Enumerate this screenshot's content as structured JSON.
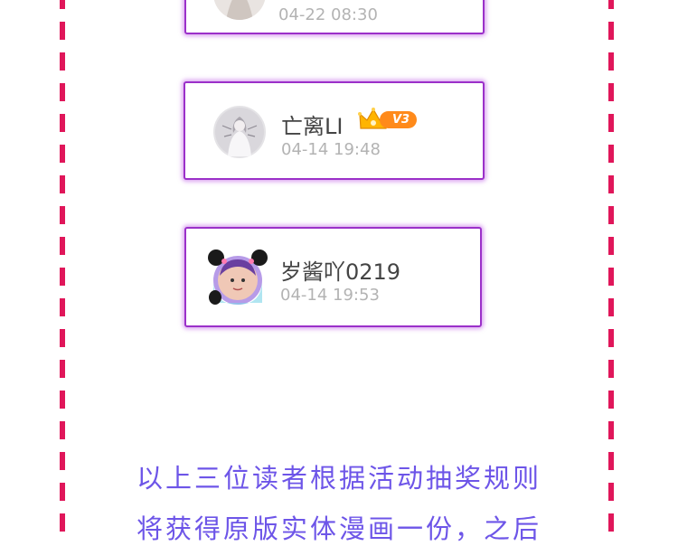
{
  "colors": {
    "dash": "#e0165a",
    "card_border": "#9b30c9",
    "timestamp": "#b3b3b3",
    "note_text": "#6d55e8",
    "badge": "#ff8a1a"
  },
  "winners": [
    {
      "name": "",
      "time": "04-22 08:30",
      "avatar_icon": "white-figure-avatar-icon"
    },
    {
      "name": "亡离LI",
      "time": "04-14 19:48",
      "badge_label": "V3",
      "badge_icon": "crown-icon",
      "avatar_icon": "white-figure-avatar-icon"
    },
    {
      "name": "岁酱吖0219",
      "time": "04-14 19:53",
      "avatar_icon": "panda-frame-avatar-icon"
    }
  ],
  "note": {
    "line1": "以上三位读者根据活动抽奖规则",
    "line2": "将获得原版实体漫画一份，之后"
  }
}
